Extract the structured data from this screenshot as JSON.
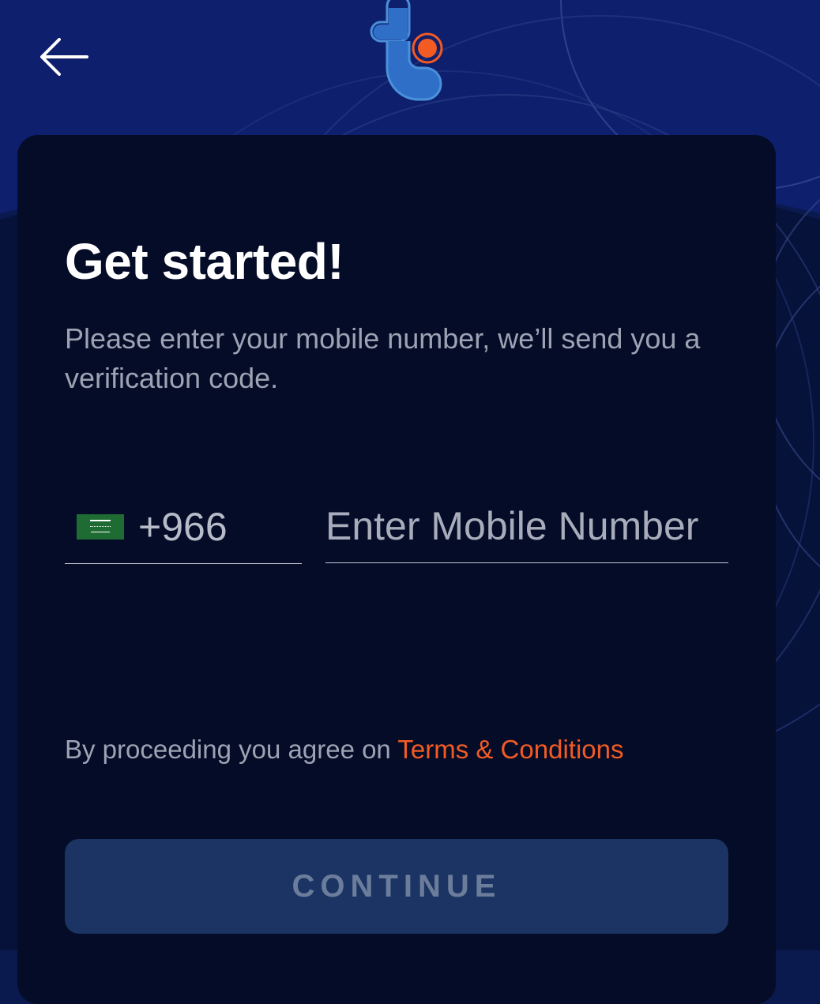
{
  "header": {
    "back_icon": "arrow-left-icon",
    "logo_icon": "brand-t-logo-icon"
  },
  "main": {
    "title": "Get started!",
    "subtitle": "Please enter your mobile number, we’ll send you a verification code."
  },
  "phone": {
    "country_flag_icon": "saudi-arabia-flag-icon",
    "dial_code": "+966",
    "mobile_placeholder": "Enter Mobile Number",
    "mobile_value": ""
  },
  "terms": {
    "prefix": "By proceeding you agree on ",
    "link_label": "Terms & Conditions"
  },
  "actions": {
    "continue_label": "CONTINUE"
  },
  "colors": {
    "background": "#0a1a4e",
    "card": "#040c28",
    "accent_orange": "#f25b24",
    "logo_blue": "#4a90d9",
    "button_disabled": "#1b3463",
    "button_text_disabled": "#6c7d9b"
  }
}
